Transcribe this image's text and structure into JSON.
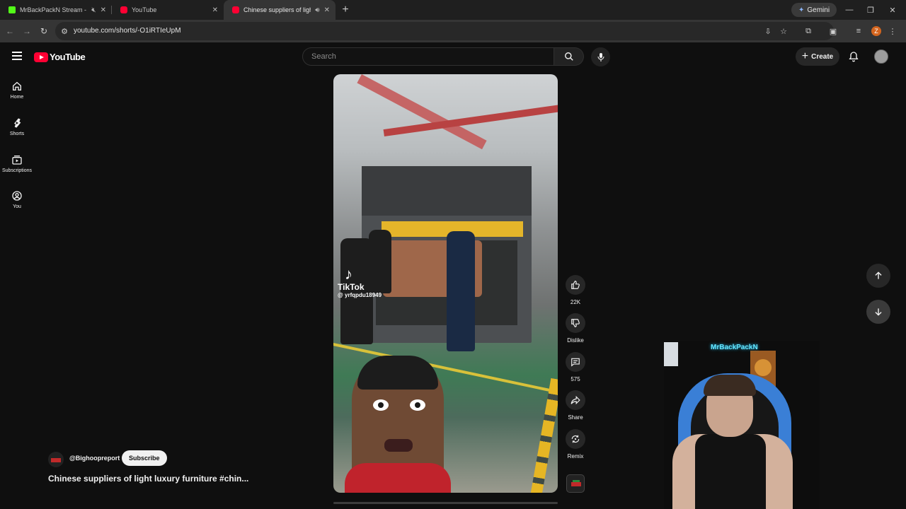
{
  "browser": {
    "tabs": [
      {
        "title": "MrBackPackN Stream - Wa",
        "favicon_color": "#53fc18",
        "muted": true
      },
      {
        "title": "YouTube",
        "favicon_color": "#ff0033",
        "muted": false
      },
      {
        "title": "Chinese suppliers of light lu",
        "favicon_color": "#ff0033",
        "muted": false,
        "active": true
      }
    ],
    "gemini_label": "Gemini",
    "url": "youtube.com/shorts/-O1iRTIeUpM",
    "profile_initial": "Z"
  },
  "youtube": {
    "logo_text": "YouTube",
    "search_placeholder": "Search",
    "create_label": "Create",
    "guide": [
      {
        "label": "Home",
        "icon": "home-icon"
      },
      {
        "label": "Shorts",
        "icon": "shorts-icon"
      },
      {
        "label": "Subscriptions",
        "icon": "subscriptions-icon"
      },
      {
        "label": "You",
        "icon": "you-icon"
      }
    ],
    "actions": {
      "like_count": "22K",
      "dislike_label": "Dislike",
      "comment_count": "575",
      "share_label": "Share",
      "remix_label": "Remix"
    },
    "short": {
      "channel": "@Bighoopreport",
      "subscribe_label": "Subscribe",
      "title": "Chinese suppliers of light luxury furniture #chin...",
      "watermark_brand": "TikTok",
      "watermark_user": "@ yrfqpdu18949"
    }
  },
  "webcam": {
    "neon_sign": "MrBackPackN"
  }
}
